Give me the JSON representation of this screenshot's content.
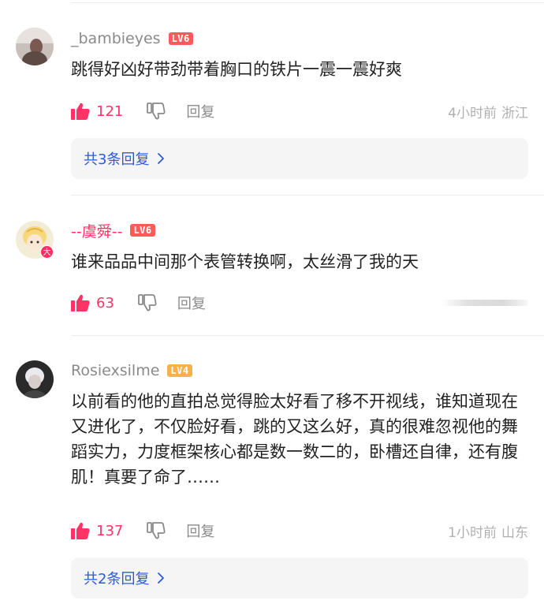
{
  "comments": [
    {
      "username": "_bambieyes",
      "level": "LV6",
      "text": "跳得好凶好带劲带着胸口的铁片一震一震好爽",
      "likes": "121",
      "reply_label": "回复",
      "time": "4小时前",
      "location": "浙江",
      "replies_label": "共3条回复"
    },
    {
      "username": "--虞舜--",
      "level": "LV6",
      "avatar_badge": "大",
      "text": "谁来品品中间那个表管转换啊，太丝滑了我的天",
      "likes": "63",
      "reply_label": "回复"
    },
    {
      "username": "Rosiexsilme",
      "level": "LV4",
      "text": "以前看的他的直拍总觉得脸太好看了移不开视线，谁知道现在又进化了，不仅脸好看，跳的又这么好，真的很难忽视他的舞蹈实力，力度框架核心都是数一数二的，卧槽还自律，还有腹肌！真要了命了……",
      "likes": "137",
      "reply_label": "回复",
      "time": "1小时前",
      "location": "山东",
      "replies_label": "共2条回复"
    }
  ],
  "colors": {
    "accent_like": "#ff3366",
    "link_blue": "#2b5bd7",
    "level6": "#ff5a5a",
    "level4": "#f5b14c"
  },
  "icons": [
    "thumbs-up-icon",
    "thumbs-down-icon",
    "chevron-right-icon"
  ]
}
